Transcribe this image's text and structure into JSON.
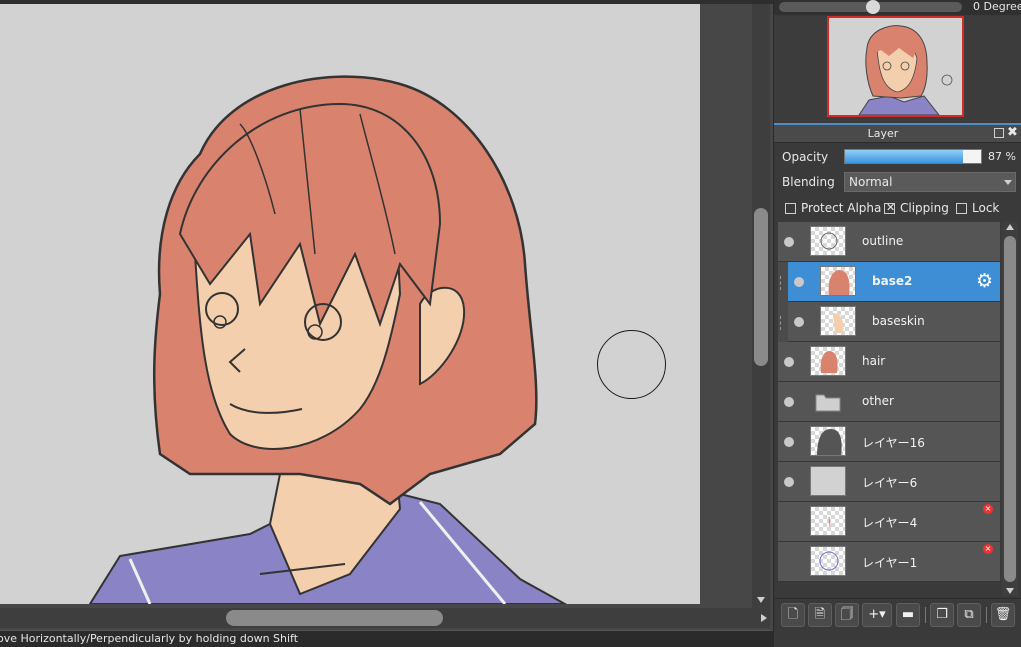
{
  "status_bar": {
    "text": "ove Horizontally/Perpendicularly by holding down Shift"
  },
  "rotation": {
    "value_text": "0 Degree",
    "level_fraction": 0.5
  },
  "layer_panel": {
    "title": "Layer",
    "opacity": {
      "label": "Opacity",
      "value": 87,
      "value_text": "87 %"
    },
    "blending": {
      "label": "Blending",
      "value": "Normal"
    },
    "options": {
      "protect_alpha": {
        "label": "Protect Alpha",
        "checked": false
      },
      "clipping": {
        "label": "Clipping",
        "checked": true
      },
      "lock": {
        "label": "Lock",
        "checked": false
      }
    },
    "layers": [
      {
        "name": "outline",
        "visible": true,
        "selected": false,
        "clipped": false,
        "thumb": "outline"
      },
      {
        "name": "base2",
        "visible": true,
        "selected": true,
        "clipped": true,
        "thumb": "hair-red"
      },
      {
        "name": "baseskin",
        "visible": true,
        "selected": false,
        "clipped": true,
        "thumb": "skin"
      },
      {
        "name": "hair",
        "visible": true,
        "selected": false,
        "clipped": false,
        "thumb": "hair-small"
      },
      {
        "name": "other",
        "visible": true,
        "selected": false,
        "clipped": false,
        "thumb": "folder"
      },
      {
        "name": "レイヤー16",
        "visible": true,
        "selected": false,
        "clipped": false,
        "thumb": "silhouette"
      },
      {
        "name": "レイヤー6",
        "visible": true,
        "selected": false,
        "clipped": false,
        "thumb": "gray"
      },
      {
        "name": "レイヤー4",
        "visible": false,
        "selected": false,
        "clipped": false,
        "thumb": "mark"
      },
      {
        "name": "レイヤー1",
        "visible": false,
        "selected": false,
        "clipped": false,
        "thumb": "sketch"
      }
    ]
  },
  "toolbar_icons": [
    "new-layer-icon",
    "new-layer-8bit-icon",
    "new-layer-1bit-icon",
    "add-layer-menu-icon",
    "new-folder-icon",
    "duplicate-layer-icon",
    "merge-down-icon",
    "delete-layer-icon"
  ],
  "colors": {
    "selected": "#3d8ed4",
    "hair": "#d9836f",
    "skin": "#f3cfad",
    "uniform": "#8680c4",
    "canvas_bg": "#d2d2d2"
  }
}
